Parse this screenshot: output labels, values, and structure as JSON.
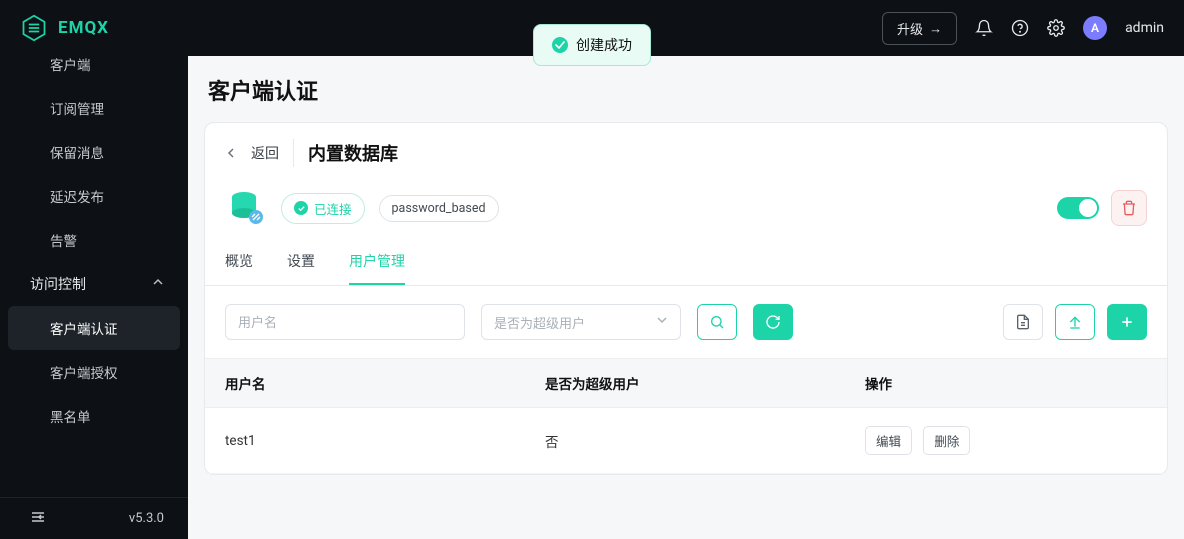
{
  "header": {
    "logo_text": "EMQX",
    "upgrade_label": "升级",
    "admin_initial": "A",
    "admin_name": "admin"
  },
  "toast": {
    "message": "创建成功"
  },
  "sidebar": {
    "items": [
      {
        "label": "客户端"
      },
      {
        "label": "订阅管理"
      },
      {
        "label": "保留消息"
      },
      {
        "label": "延迟发布"
      },
      {
        "label": "告警"
      }
    ],
    "group": {
      "label": "访问控制"
    },
    "subitems": [
      {
        "label": "客户端认证",
        "active": true
      },
      {
        "label": "客户端授权"
      },
      {
        "label": "黑名单"
      }
    ],
    "version": "v5.3.0"
  },
  "main": {
    "page_title": "客户端认证",
    "back_label": "返回",
    "db_title": "内置数据库",
    "status": {
      "connected_label": "已连接",
      "mechanism_label": "password_based"
    },
    "tabs": [
      {
        "label": "概览"
      },
      {
        "label": "设置"
      },
      {
        "label": "用户管理",
        "active": true
      }
    ],
    "filters": {
      "username_placeholder": "用户名",
      "superuser_placeholder": "是否为超级用户"
    },
    "table": {
      "headers": {
        "username": "用户名",
        "superuser": "是否为超级用户",
        "action": "操作"
      },
      "rows": [
        {
          "username": "test1",
          "superuser": "否",
          "edit": "编辑",
          "delete": "删除"
        }
      ]
    }
  }
}
